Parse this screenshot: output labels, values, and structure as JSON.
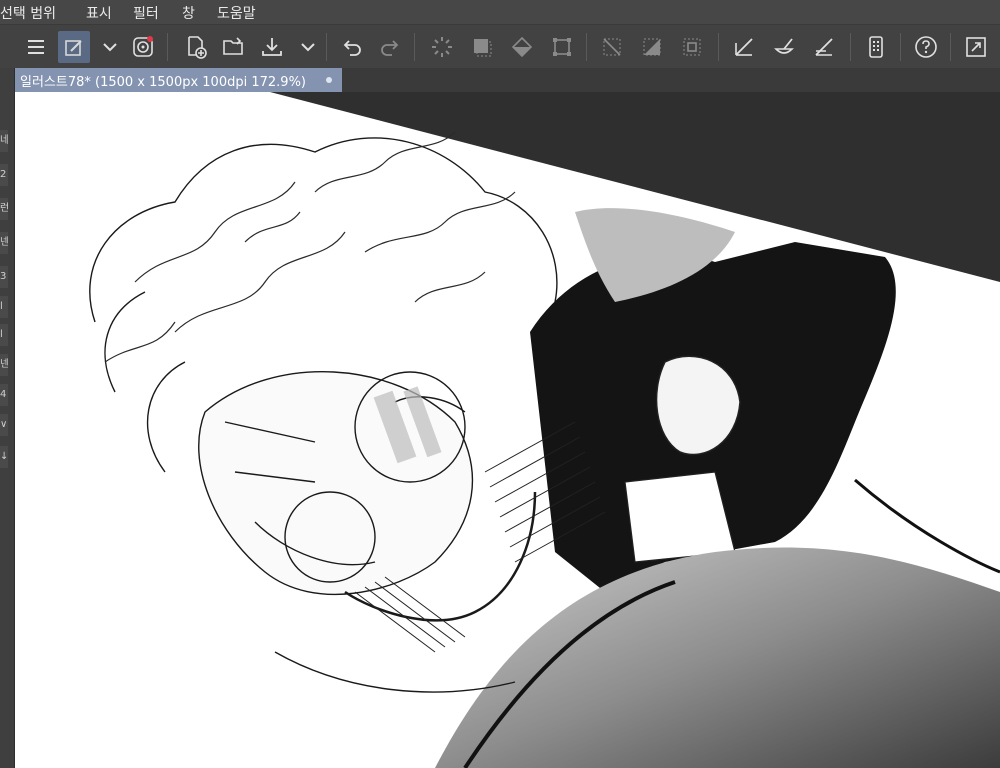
{
  "menu": [
    "선택 범위",
    "표시",
    "필터",
    "창",
    "도움말"
  ],
  "toolbar": {
    "buttons": [
      {
        "name": "menu-icon"
      },
      {
        "name": "edit-mode-icon"
      },
      {
        "name": "chevron-down-icon"
      },
      {
        "name": "companion-icon"
      },
      {
        "name": "new-canvas-icon"
      },
      {
        "name": "open-folder-icon"
      },
      {
        "name": "save-icon"
      },
      {
        "name": "chevron-down-icon"
      },
      {
        "name": "undo-icon"
      },
      {
        "name": "redo-icon"
      },
      {
        "name": "loading-icon"
      },
      {
        "name": "select-all-icon"
      },
      {
        "name": "fill-icon"
      },
      {
        "name": "transform-icon"
      },
      {
        "name": "deselect-icon"
      },
      {
        "name": "invert-selection-icon"
      },
      {
        "name": "selection-border-icon"
      },
      {
        "name": "ruler-icon"
      },
      {
        "name": "fill-bucket-icon"
      },
      {
        "name": "line-icon"
      },
      {
        "name": "device-icon"
      },
      {
        "name": "help-icon"
      },
      {
        "name": "fullscreen-icon"
      }
    ]
  },
  "document_tab": {
    "title": "일러스트78* (1500 x 1500px 100dpi 172.9%)"
  },
  "left_strip_glyphs": [
    "네",
    "2",
    "런",
    "넨",
    "3",
    "l",
    "l",
    "넨",
    "4",
    "∨",
    "↓"
  ],
  "colors": {
    "menubar_bg": "#474747",
    "toolbar_bg": "#424242",
    "tab_active": "#8493b0",
    "canvas_bg": "#2f2f2f",
    "toggle_active": "#5a6a84",
    "companion_dot": "#e0394a"
  }
}
